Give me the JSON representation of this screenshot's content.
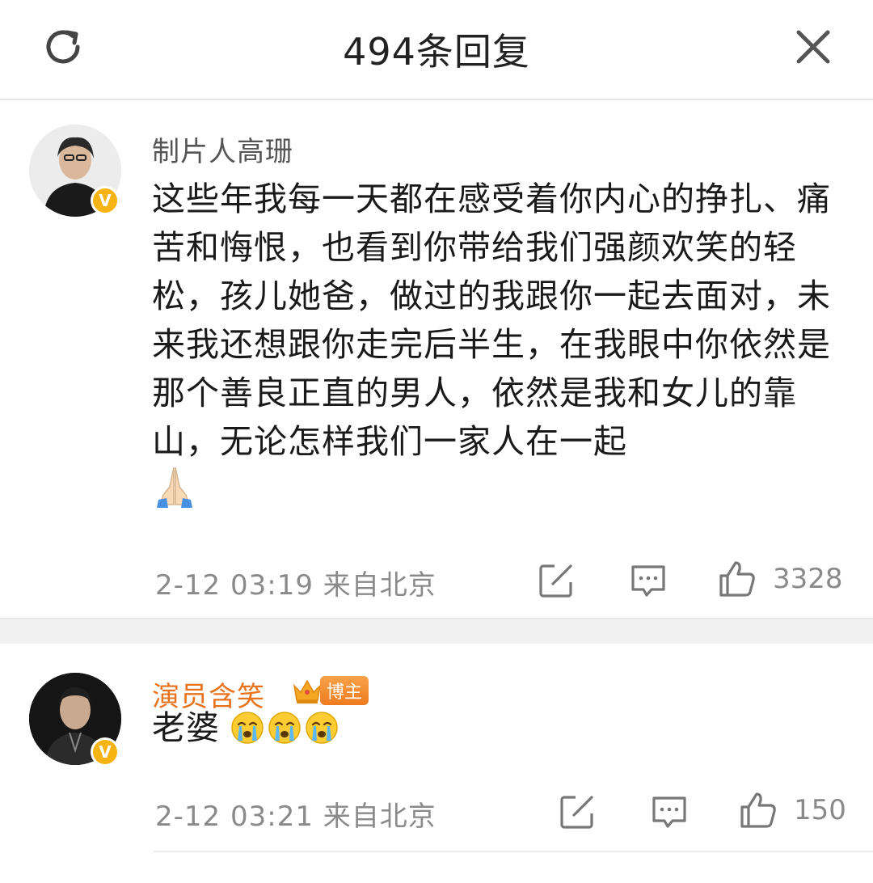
{
  "header": {
    "title": "494条回复",
    "refresh_icon": "refresh-icon",
    "close_icon": "close-icon"
  },
  "comments": [
    {
      "username": "制片人高珊",
      "verified": "V",
      "text": "这些年我每一天都在感受着你内心的挣扎、痛苦和悔恨，也看到你带给我们强颜欢笑的轻松，孩儿她爸，做过的我跟你一起去面对，未来我还想跟你走完后半生，在我眼中你依然是那个善良正直的男人，依然是我和女儿的靠山，无论怎样我们一家人在一起",
      "emoji": "pray-emoji",
      "time": "2-12 03:19",
      "location": "来自北京",
      "likes": "3328"
    },
    {
      "username": "演员含笑",
      "verified": "V",
      "badge": "博主",
      "text": "老婆",
      "emoji": "crying-emoji",
      "time": "2-12 03:21",
      "location": "来自北京",
      "likes": "150"
    }
  ],
  "colors": {
    "accent_orange": "#e8731c",
    "verified_gold": "#f6b311",
    "meta_gray": "#8a8a8a"
  }
}
